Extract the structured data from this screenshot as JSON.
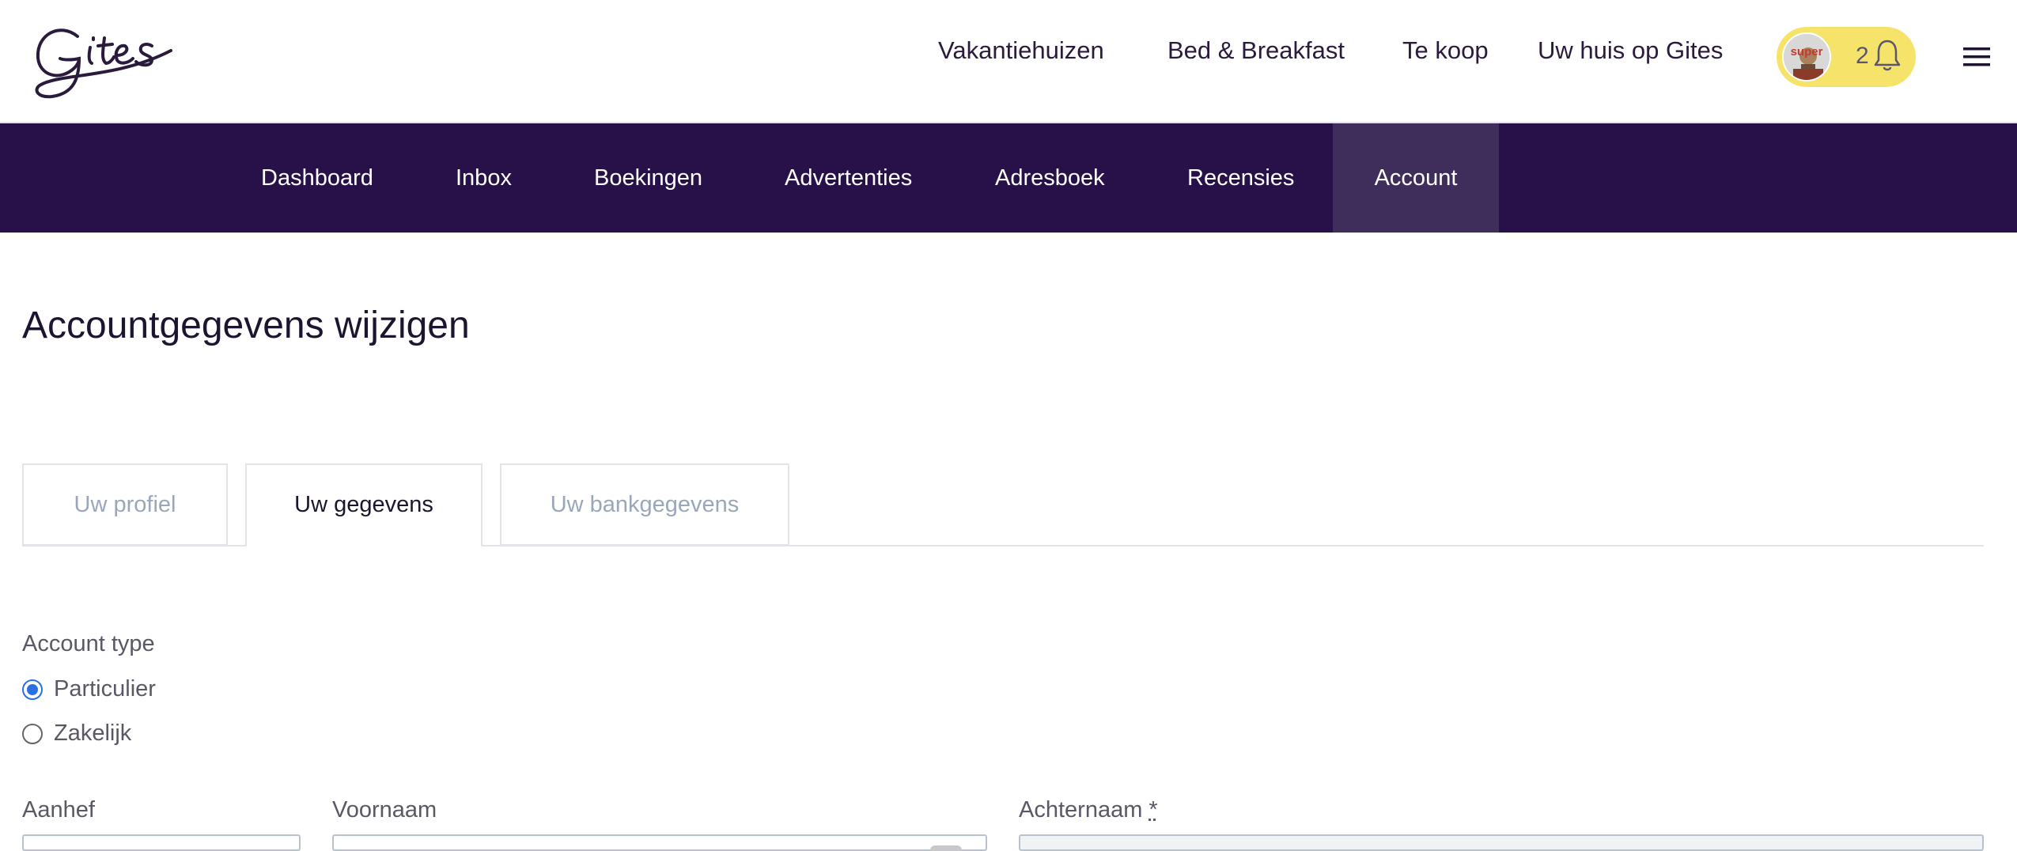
{
  "header": {
    "logo_text": "Gites",
    "nav": [
      "Vakantiehuizen",
      "Bed & Breakfast",
      "Te koop",
      "Uw huis op Gites"
    ],
    "user": {
      "avatar_text": "super",
      "notification_count": "2"
    },
    "icons": {
      "bell": "bell-icon",
      "menu": "hamburger-menu-icon"
    },
    "colors": {
      "pill": "#f6e46a"
    }
  },
  "subnav": {
    "items": [
      "Dashboard",
      "Inbox",
      "Boekingen",
      "Advertenties",
      "Adresboek",
      "Recensies",
      "Account"
    ],
    "active": "Account",
    "colors": {
      "bg": "#281048",
      "active_bg": "#3f2d5c"
    }
  },
  "page": {
    "title": "Accountgegevens wijzigen",
    "tabs": [
      {
        "label": "Uw profiel",
        "active": false
      },
      {
        "label": "Uw gegevens",
        "active": true
      },
      {
        "label": "Uw bankgegevens",
        "active": false
      }
    ]
  },
  "form": {
    "account_type_label": "Account type",
    "account_types": [
      {
        "label": "Particulier",
        "checked": true
      },
      {
        "label": "Zakelijk",
        "checked": false
      }
    ],
    "aanhef_label": "Aanhef",
    "voornaam_label": "Voornaam",
    "achternaam_label": "Achternaam",
    "required_mark": "*"
  }
}
